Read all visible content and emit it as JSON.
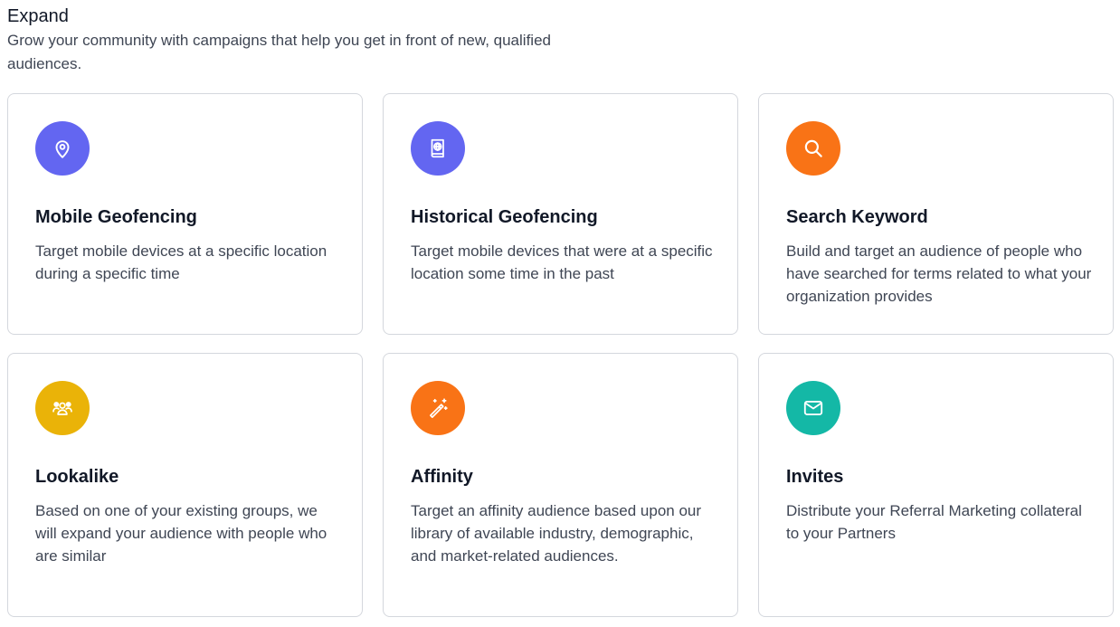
{
  "section": {
    "title": "Expand",
    "subtitle": "Grow your community with campaigns that help you get in front of new, qualified audiences."
  },
  "cards": [
    {
      "title": "Mobile Geofencing",
      "description": "Target mobile devices at a specific location during a specific time",
      "icon": "location-pin-icon",
      "color": "#6366f1"
    },
    {
      "title": "Historical Geofencing",
      "description": "Target mobile devices that were at a specific location some time in the past",
      "icon": "globe-book-icon",
      "color": "#6366f1"
    },
    {
      "title": "Search Keyword",
      "description": "Build and target an audience of people who have searched for terms related to what your organization provides",
      "icon": "search-icon",
      "color": "#f97316"
    },
    {
      "title": "Lookalike",
      "description": "Based on one of your existing groups, we will expand your audience with people who are similar",
      "icon": "users-group-icon",
      "color": "#eab308"
    },
    {
      "title": "Affinity",
      "description": "Target an affinity audience based upon our library of available industry, demographic, and market-related audiences.",
      "icon": "magic-wand-icon",
      "color": "#f97316"
    },
    {
      "title": "Invites",
      "description": "Distribute your Referral Marketing collateral to your Partners",
      "icon": "envelope-icon",
      "color": "#14b8a6"
    }
  ]
}
